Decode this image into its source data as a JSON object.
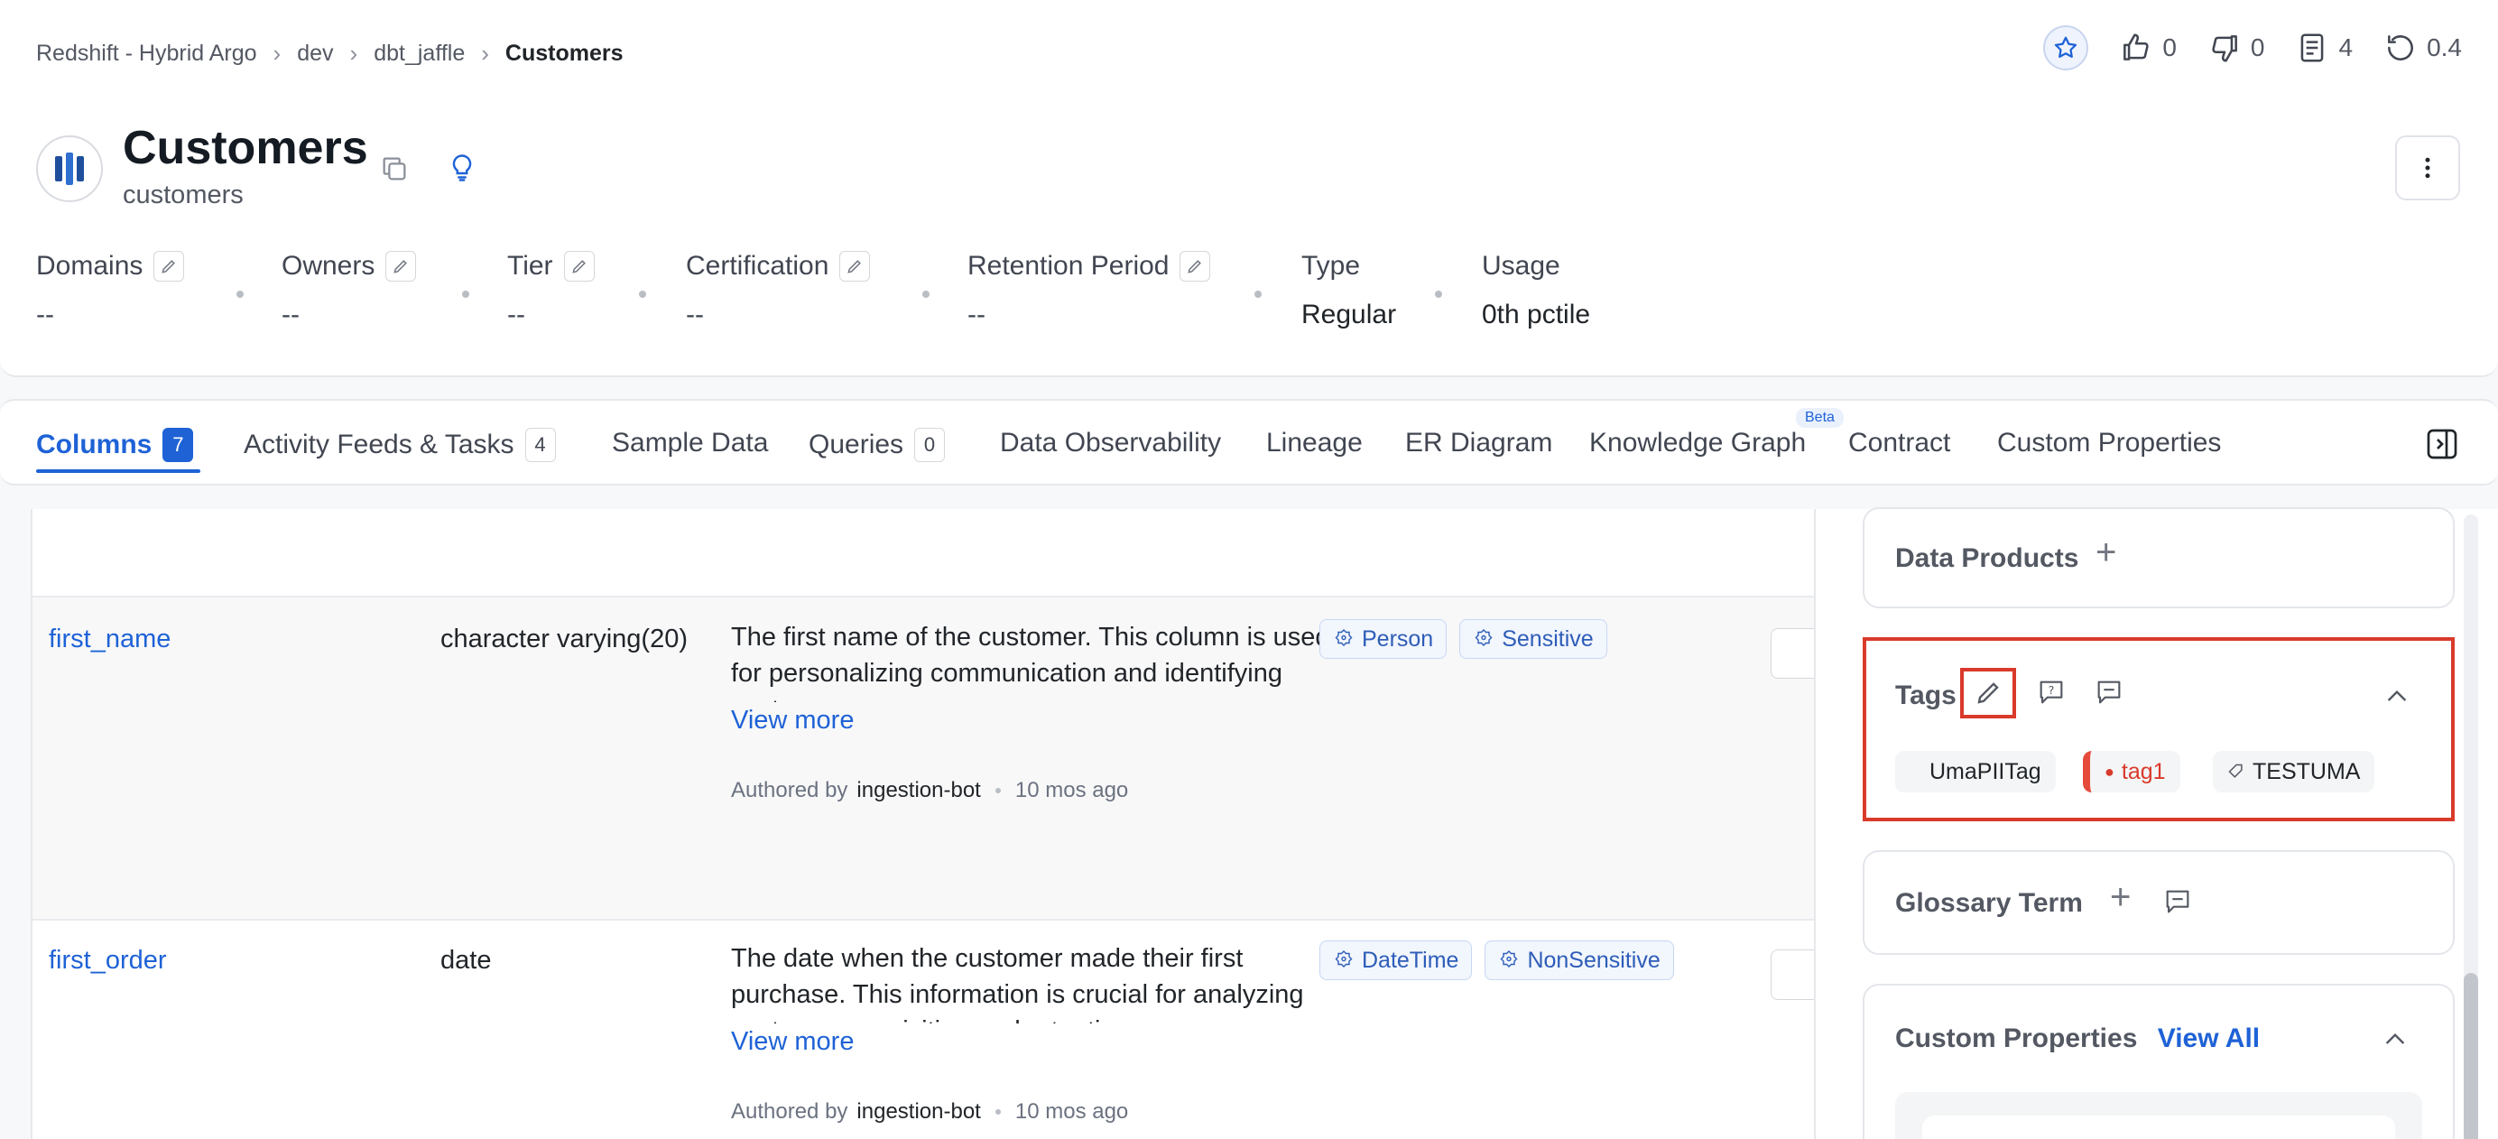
{
  "breadcrumb": {
    "items": [
      "Redshift - Hybrid Argo",
      "dev",
      "dbt_jaffle"
    ],
    "current": "Customers"
  },
  "top_actions": {
    "likes": "0",
    "dislikes": "0",
    "versions_docs": "4",
    "version": "0.4"
  },
  "entity": {
    "title": "Customers",
    "subtitle": "customers"
  },
  "properties": {
    "domains": {
      "label": "Domains",
      "value": "--"
    },
    "owners": {
      "label": "Owners",
      "value": "--"
    },
    "tier": {
      "label": "Tier",
      "value": "--"
    },
    "certification": {
      "label": "Certification",
      "value": "--"
    },
    "retention": {
      "label": "Retention Period",
      "value": "--"
    },
    "type": {
      "label": "Type",
      "value": "Regular"
    },
    "usage": {
      "label": "Usage",
      "value": "0th pctile"
    }
  },
  "tabs": {
    "columns": {
      "label": "Columns",
      "count": "7"
    },
    "activity": {
      "label": "Activity Feeds & Tasks",
      "count": "4"
    },
    "sample": {
      "label": "Sample Data"
    },
    "queries": {
      "label": "Queries",
      "count": "0"
    },
    "observability": {
      "label": "Data Observability"
    },
    "lineage": {
      "label": "Lineage"
    },
    "er": {
      "label": "ER Diagram"
    },
    "knowledge": {
      "label": "Knowledge Graph",
      "badge": "Beta"
    },
    "contract": {
      "label": "Contract"
    },
    "custom": {
      "label": "Custom Properties"
    }
  },
  "rows": [
    {
      "name": "first_name",
      "type": "character varying(20)",
      "description": "The first name of the customer. This column is used for personalizing communication and identifying customers.",
      "view_more": "View more",
      "authored_prefix": "Authored by",
      "author": "ingestion-bot",
      "time": "10 mos ago",
      "tags": [
        "Person",
        "Sensitive"
      ]
    },
    {
      "name": "first_order",
      "type": "date",
      "description": "The date when the customer made their first purchase. This information is crucial for analyzing customer acquisition and retention.",
      "view_more": "View more",
      "authored_prefix": "Authored by",
      "author": "ingestion-bot",
      "time": "10 mos ago",
      "tags": [
        "DateTime",
        "NonSensitive"
      ]
    }
  ],
  "side_panel": {
    "data_products": {
      "title": "Data Products"
    },
    "tags": {
      "title": "Tags",
      "items": [
        "UmaPIITag",
        "tag1",
        "TESTUMA"
      ]
    },
    "glossary": {
      "title": "Glossary Term"
    },
    "custom_properties": {
      "title": "Custom Properties",
      "view_all": "View All"
    }
  },
  "colors": {
    "accent": "#1e62d6",
    "highlight_red": "#d93a2b"
  }
}
